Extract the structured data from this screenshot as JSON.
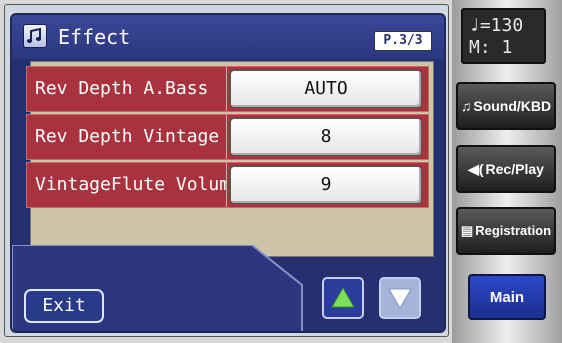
{
  "header": {
    "title": "Effect",
    "title_icon": "music-notes-icon",
    "page_indicator": "P.3/3"
  },
  "params": [
    {
      "label": "Rev Depth A.Bass",
      "value": "AUTO"
    },
    {
      "label": "Rev Depth Vintage",
      "value": "8"
    },
    {
      "label": "VintageFlute Volume",
      "value": "9"
    }
  ],
  "footer": {
    "exit_label": "Exit",
    "up_icon": "up-arrow-icon",
    "down_icon": "down-arrow-icon"
  },
  "side": {
    "tempo_line": "♩=130",
    "measure_line": "M:   1",
    "buttons": [
      {
        "label": "Sound/KBD",
        "icon": "music-note-icon"
      },
      {
        "label": "Rec/Play",
        "icon": "speaker-icon"
      },
      {
        "label": "Registration",
        "icon": "book-icon"
      }
    ],
    "main_label": "Main"
  },
  "colors": {
    "screen_bg": "#26306e",
    "param_row": "#a8333f",
    "content_bg": "#ccc4a4",
    "main_button": "#2c48c8"
  }
}
